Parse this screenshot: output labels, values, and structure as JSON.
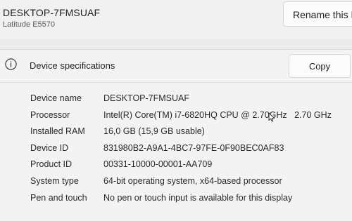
{
  "header": {
    "device_name": "DESKTOP-7FMSUAF",
    "model": "Latitude E5570",
    "rename_label": "Rename this PC"
  },
  "specs_card": {
    "icon": "info-icon",
    "title": "Device specifications",
    "copy_label": "Copy",
    "rows": [
      {
        "label": "Device name",
        "value": "DESKTOP-7FMSUAF"
      },
      {
        "label": "Processor",
        "value": "Intel(R) Core(TM) i7-6820HQ CPU @ 2.70GHz   2.70 GHz"
      },
      {
        "label": "Installed RAM",
        "value": "16,0 GB (15,9 GB usable)"
      },
      {
        "label": "Device ID",
        "value": "831980B2-A9A1-4BC7-97FE-0F90BEC0AF83"
      },
      {
        "label": "Product ID",
        "value": "00331-10000-00001-AA709"
      },
      {
        "label": "System type",
        "value": "64-bit operating system, x64-based processor"
      },
      {
        "label": "Pen and touch",
        "value": "No pen or touch input is available for this display"
      }
    ]
  },
  "colors": {
    "background": "#eceaea",
    "card": "#f4f3f3",
    "text": "#1d1d1d"
  }
}
